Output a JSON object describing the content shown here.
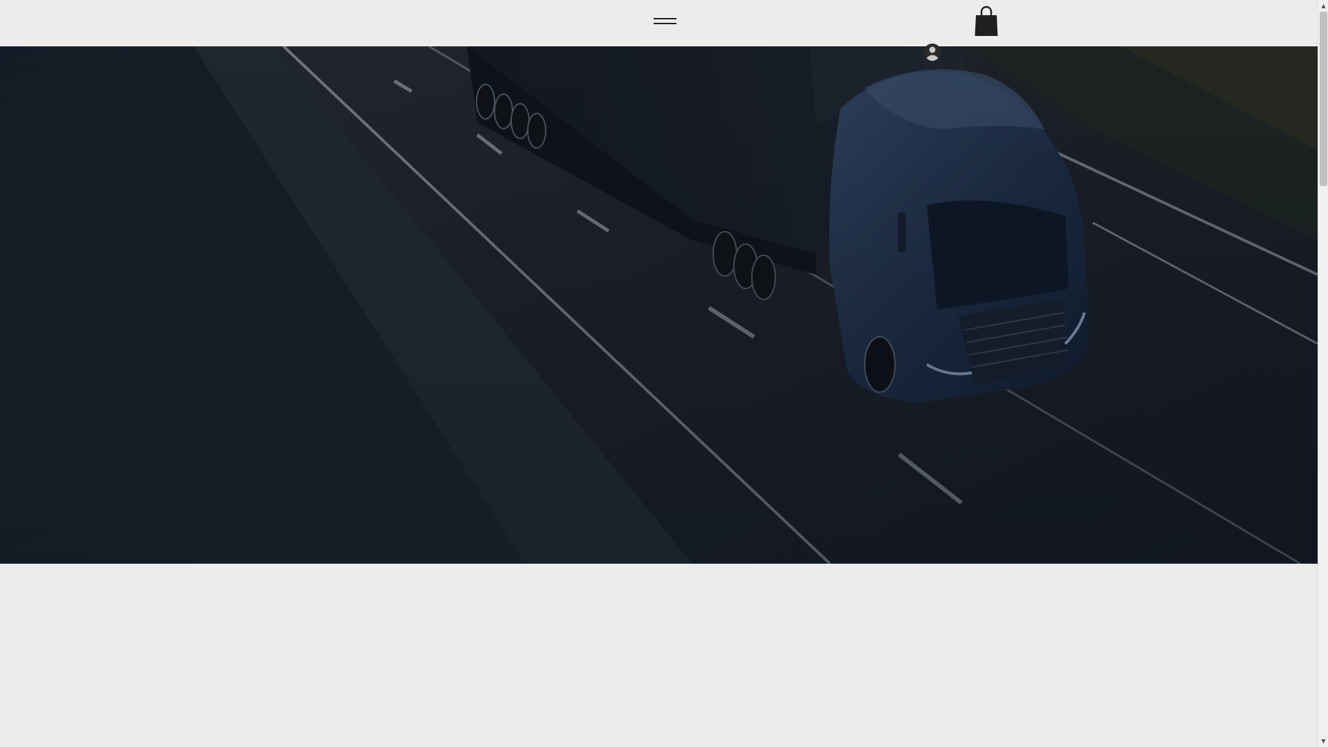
{
  "header": {
    "menu_icon": "hamburger-menu-icon",
    "cart_icon": "shopping-bag-icon",
    "login_icon": "user-avatar-icon"
  },
  "hero": {
    "image": "truck-on-highway-photo",
    "overlay_color": "#0b1420"
  },
  "colors": {
    "page_background": "#ececec",
    "icon_color": "#1f1f1f"
  },
  "scrollbar": {
    "up_arrow": "▲",
    "down_arrow": "▼",
    "scrolled_fraction": 0.0
  }
}
